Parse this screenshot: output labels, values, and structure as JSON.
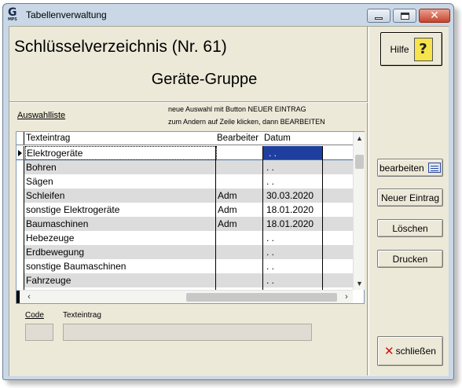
{
  "window": {
    "title": "Tabellenverwaltung",
    "icon_letter": "G",
    "icon_caption": "MPS"
  },
  "header": {
    "title": "Schlüsselverzeichnis (Nr. 61)",
    "subtitle": "Geräte-Gruppe"
  },
  "list": {
    "label": "Auswahlliste",
    "hint_line1": "neue Auswahl mit Button NEUER EINTRAG",
    "hint_line2": "zum Andern auf Zeile klicken, dann BEARBEITEN",
    "columns": [
      "Texteintrag",
      "Bearbeiter",
      "Datum"
    ],
    "rows": [
      {
        "text": "Elektrogeräte",
        "user": "",
        "date": ". ."
      },
      {
        "text": "Bohren",
        "user": "",
        "date": ". ."
      },
      {
        "text": "Sägen",
        "user": "",
        "date": ". ."
      },
      {
        "text": "Schleifen",
        "user": "Adm",
        "date": "30.03.2020"
      },
      {
        "text": "sonstige Elektrogeräte",
        "user": "Adm",
        "date": "18.01.2020"
      },
      {
        "text": "Baumaschinen",
        "user": "Adm",
        "date": "18.01.2020"
      },
      {
        "text": "Hebezeuge",
        "user": "",
        "date": ". ."
      },
      {
        "text": "Erdbewegung",
        "user": "",
        "date": ". ."
      },
      {
        "text": "sonstige Baumaschinen",
        "user": "",
        "date": ". ."
      },
      {
        "text": "Fahrzeuge",
        "user": "",
        "date": ". ."
      },
      {
        "text": "",
        "user": "",
        "date": ""
      }
    ]
  },
  "form": {
    "code_label": "Code",
    "text_label": "Texteintrag",
    "code_value": "",
    "text_value": ""
  },
  "buttons": {
    "help": "Hilfe",
    "edit": "bearbeiten",
    "new_entry": "Neuer Eintrag",
    "delete": "Löschen",
    "print": "Drucken",
    "close": "schließen"
  },
  "colors": {
    "selection": "#1f3f9f",
    "close_button": "#c8432b"
  }
}
